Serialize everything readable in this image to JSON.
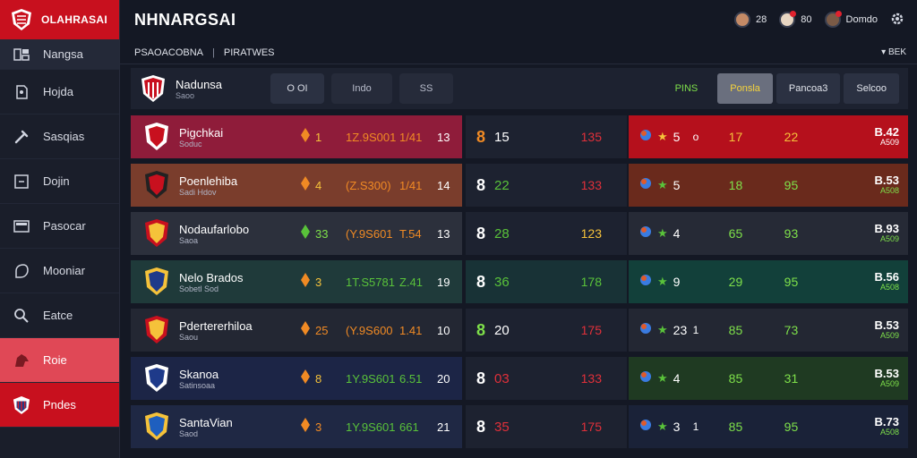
{
  "sidebar": {
    "brand": "OLAHRASAI",
    "items": [
      {
        "label": "Nangsa",
        "icon": "grid-icon"
      },
      {
        "label": "Hojda",
        "icon": "user-icon"
      },
      {
        "label": "Sasqias",
        "icon": "wrench-icon"
      },
      {
        "label": "Dojin",
        "icon": "window-icon"
      },
      {
        "label": "Pasocar",
        "icon": "monitor-icon"
      },
      {
        "label": "Mooniar",
        "icon": "shield-outline-icon"
      },
      {
        "label": "Eatce",
        "icon": "search-icon"
      },
      {
        "label": "Roie",
        "icon": "horse-icon"
      },
      {
        "label": "Pndes",
        "icon": "club-crest-icon"
      }
    ]
  },
  "header": {
    "title": "NHNARGSAI",
    "users": [
      {
        "label": "28"
      },
      {
        "label": "80"
      },
      {
        "label": "Domdo"
      }
    ]
  },
  "subbar": {
    "left": "PSAOACOBNA",
    "middle": "PIRATWES",
    "right": "BEK"
  },
  "filter": {
    "team_name": "Nadunsa",
    "team_sub": "Saoo",
    "pills": [
      "O OI",
      "Indo",
      "SS"
    ],
    "plain_tab": "PINS",
    "tabs": [
      "Ponsla",
      "Pancoa3",
      "Selcoo"
    ]
  },
  "rows": [
    {
      "name": "Pigchkai",
      "sub": "Soduc",
      "gem": "1",
      "odds": "1Z.9S001",
      "ratio": "1/41",
      "count": "13",
      "mid_a": "8",
      "mid_b": "15",
      "mid_c": "135",
      "c_icon": "5",
      "c_a": "o",
      "c_b": "17",
      "c_c": "22",
      "c_d": "B.42",
      "c_e": "A509",
      "color": "#8f1c3a"
    },
    {
      "name": "Poenlehiba",
      "sub": "Sadi Hdov",
      "gem": "4",
      "odds": "(Z.S300)",
      "ratio": "1/41",
      "count": "14",
      "mid_a": "8",
      "mid_b": "22",
      "mid_c": "133",
      "c_icon": "5",
      "c_a": "",
      "c_b": "18",
      "c_c": "95",
      "c_d": "B.53",
      "c_e": "A508",
      "color": "#7a3d2c"
    },
    {
      "name": "Nodaufarlobo",
      "sub": "Saoa",
      "gem": "33",
      "odds": "(Y.9S601",
      "ratio": "T.54",
      "count": "13",
      "mid_a": "8",
      "mid_b": "28",
      "mid_c": "123",
      "c_icon": "4",
      "c_a": "",
      "c_b": "65",
      "c_c": "93",
      "c_d": "B.93",
      "c_e": "A509",
      "color": "#2c303c"
    },
    {
      "name": "Nelo Brados",
      "sub": "Sobetl Sod",
      "gem": "3",
      "odds": "1T.S5781",
      "ratio": "Z.41",
      "count": "19",
      "mid_a": "8",
      "mid_b": "36",
      "mid_c": "178",
      "c_icon": "9",
      "c_a": "",
      "c_b": "29",
      "c_c": "95",
      "c_d": "B.56",
      "c_e": "A508",
      "color": "#1f3a3a"
    },
    {
      "name": "Pdertererhiloa",
      "sub": "Saou",
      "gem": "25",
      "odds": "(Y.9S600",
      "ratio": "1.41",
      "count": "10",
      "mid_a": "8",
      "mid_b": "20",
      "mid_c": "175",
      "c_icon": "23",
      "c_a": "1",
      "c_b": "85",
      "c_c": "73",
      "c_d": "B.53",
      "c_e": "A509",
      "color": "#232733"
    },
    {
      "name": "Skanoa",
      "sub": "Satinsoaa",
      "gem": "8",
      "odds": "1Y.9S601",
      "ratio": "6.51",
      "count": "20",
      "mid_a": "8",
      "mid_b": "03",
      "mid_c": "133",
      "c_icon": "4",
      "c_a": "",
      "c_b": "85",
      "c_c": "31",
      "c_d": "B.53",
      "c_e": "A509",
      "color": "#1c2546"
    },
    {
      "name": "SantaVian",
      "sub": "Saod",
      "gem": "3",
      "odds": "1Y.9S601",
      "ratio": "661",
      "count": "21",
      "mid_a": "8",
      "mid_b": "35",
      "mid_c": "175",
      "c_icon": "3",
      "c_a": "1",
      "c_b": "85",
      "c_c": "95",
      "c_d": "B.73",
      "c_e": "A508",
      "color": "#1f2844"
    }
  ],
  "colors": {
    "accent_red": "#c8101e",
    "green": "#7ee04a",
    "red_text": "#e0303a",
    "gold": "#f5c23a"
  }
}
